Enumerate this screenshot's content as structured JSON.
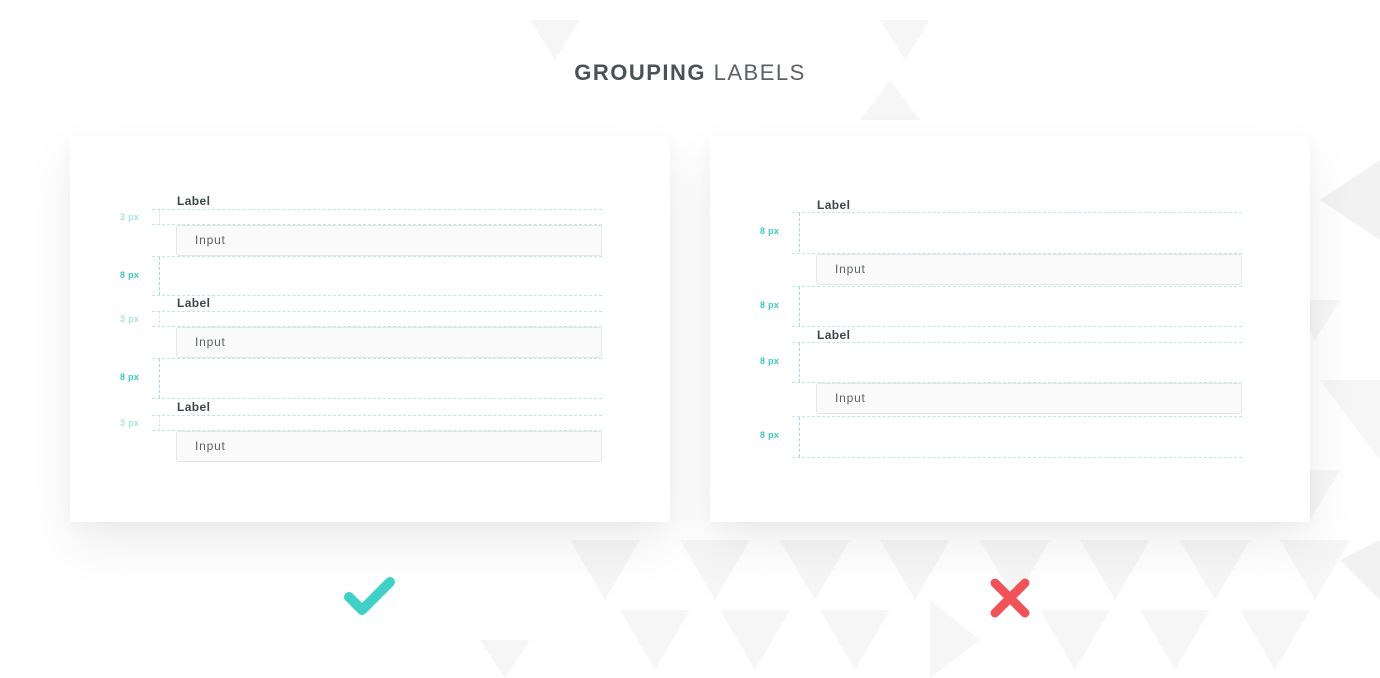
{
  "title": {
    "bold": "GROUPING",
    "light": "LABELS"
  },
  "good_panel": {
    "fields": [
      {
        "label": "Label",
        "input": "Input",
        "label_gap": "3 px"
      },
      {
        "label": "Label",
        "input": "Input",
        "label_gap": "3 px"
      },
      {
        "label": "Label",
        "input": "Input",
        "label_gap": "3 px"
      }
    ],
    "group_gaps": [
      "8 px",
      "8 px"
    ]
  },
  "bad_panel": {
    "fields": [
      {
        "label": "Label",
        "input": "Input"
      },
      {
        "label": "Label",
        "input": "Input"
      }
    ],
    "gaps": [
      "8 px",
      "8 px",
      "8 px",
      "8 px"
    ]
  },
  "marks": {
    "good": "check-icon",
    "bad": "cross-icon"
  },
  "colors": {
    "accent": "#3cc9c2",
    "accent_faint": "#a9e2de",
    "check": "#40d0c8",
    "cross": "#f0525a",
    "title": "#4a5254"
  }
}
